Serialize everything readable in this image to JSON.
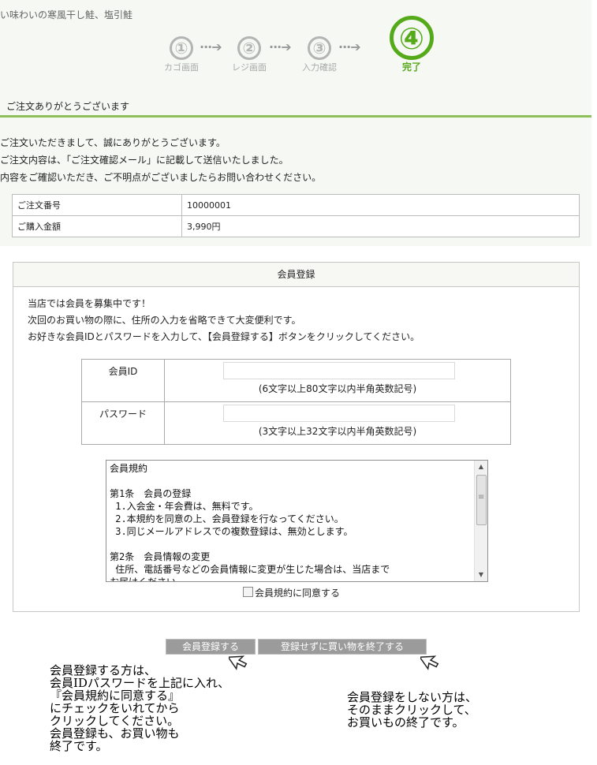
{
  "header": {
    "tagline": "い味わいの寒風干し鮭、塩引鮭"
  },
  "steps": [
    {
      "number": "①",
      "label": "カゴ画面"
    },
    {
      "number": "②",
      "label": "レジ画面"
    },
    {
      "number": "③",
      "label": "入力確認"
    },
    {
      "number": "④",
      "label": "完了"
    }
  ],
  "step_arrow": "···➔",
  "thanks": {
    "title": "ご注文ありがとうございます",
    "lines": [
      "ご注文いただきまして、誠にありがとうございます。",
      "ご注文内容は、「ご注文確認メール」に記載して送信いたしました。",
      "内容をご確認いただき、ご不明点がございましたらお問い合わせください。"
    ]
  },
  "order": {
    "rows": [
      {
        "label": "ご注文番号",
        "value": "10000001"
      },
      {
        "label": "ご購入金額",
        "value": "3,990円"
      }
    ]
  },
  "member": {
    "title": "会員登録",
    "lines": [
      "当店では会員を募集中です！",
      "次回のお買い物の際に、住所の入力を省略できて大変便利です。",
      "お好きな会員IDとパスワードを入力して、【会員登録する】ボタンをクリックしてください。"
    ],
    "id_label": "会員ID",
    "id_hint": "(6文字以上80文字以内半角英数記号)",
    "pw_label": "パスワード",
    "pw_hint": "(3文字以上32文字以内半角英数記号)",
    "terms_text": "会員規約\n\n第1条　会員の登録\n 1.入会金・年会費は、無料です。\n 2.本規約を同意の上、会員登録を行なってください。\n 3.同じメールアドレスでの複数登録は、無効とします。\n\n第2条　会員情報の変更\n 住所、電話番号などの会員情報に変更が生じた場合は、当店まで\nお届けください。",
    "agree_label": "会員規約に同意する"
  },
  "buttons": {
    "register": "会員登録する",
    "finish": "登録せずに買い物を終了する"
  },
  "notes": {
    "left": "会員登録する方は、\n会員IDパスワードを上記に入れ、\n『会員規約に同意する』\nにチェックをいれてから\nクリックしてください。\n会員登録も、お買い物も\n終了です。",
    "right": "会員登録をしない方は、\nそのままクリックして、\nお買いもの終了です。"
  },
  "icons": {
    "callout": "pointer-arrow-icon"
  },
  "colors": {
    "accent": "#55aa1a",
    "button": "#9b9b9b",
    "divider": "#8dc05a"
  }
}
